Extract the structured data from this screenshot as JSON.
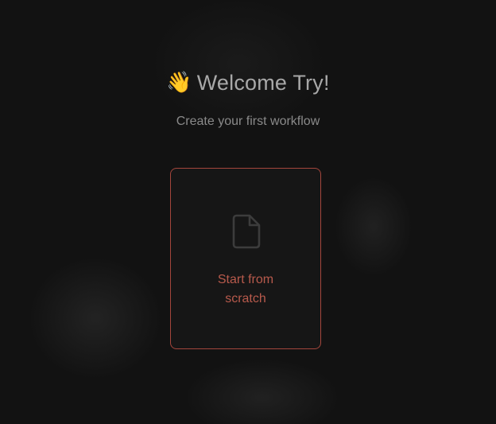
{
  "welcome": {
    "emoji": "👋",
    "title": "Welcome Try!",
    "subtitle": "Create your first workflow"
  },
  "start_card": {
    "icon": "document-icon",
    "label": "Start from scratch"
  },
  "colors": {
    "background": "#121212",
    "accent": "#b85a4c",
    "card_border": "#a4463c",
    "title_text": "#a8a8a8",
    "subtitle_text": "#8a8a8a",
    "icon": "#3c3c3c"
  }
}
